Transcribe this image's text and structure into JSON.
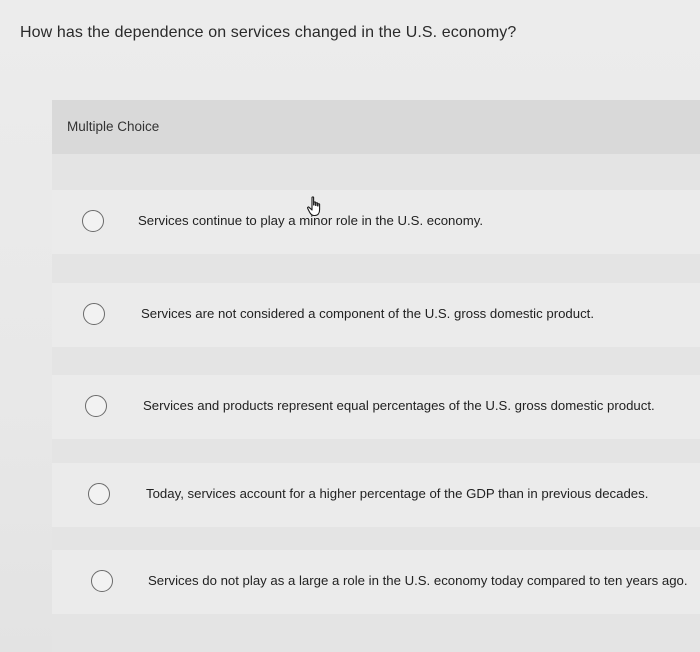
{
  "question": {
    "text": "How has the dependence on services changed in the U.S. economy?"
  },
  "section": {
    "label": "Multiple Choice"
  },
  "options": [
    {
      "label": "Services continue to play a minor role in the U.S. economy."
    },
    {
      "label": "Services are not considered a component of the U.S. gross domestic product."
    },
    {
      "label": "Services and products represent equal percentages of the U.S. gross domestic product."
    },
    {
      "label": "Today, services account for a higher percentage of the GDP than in previous decades."
    },
    {
      "label": "Services do not play as a large a role in the U.S. economy today compared to ten years ago."
    }
  ],
  "cursor": {
    "icon": "hand-pointer-icon"
  }
}
